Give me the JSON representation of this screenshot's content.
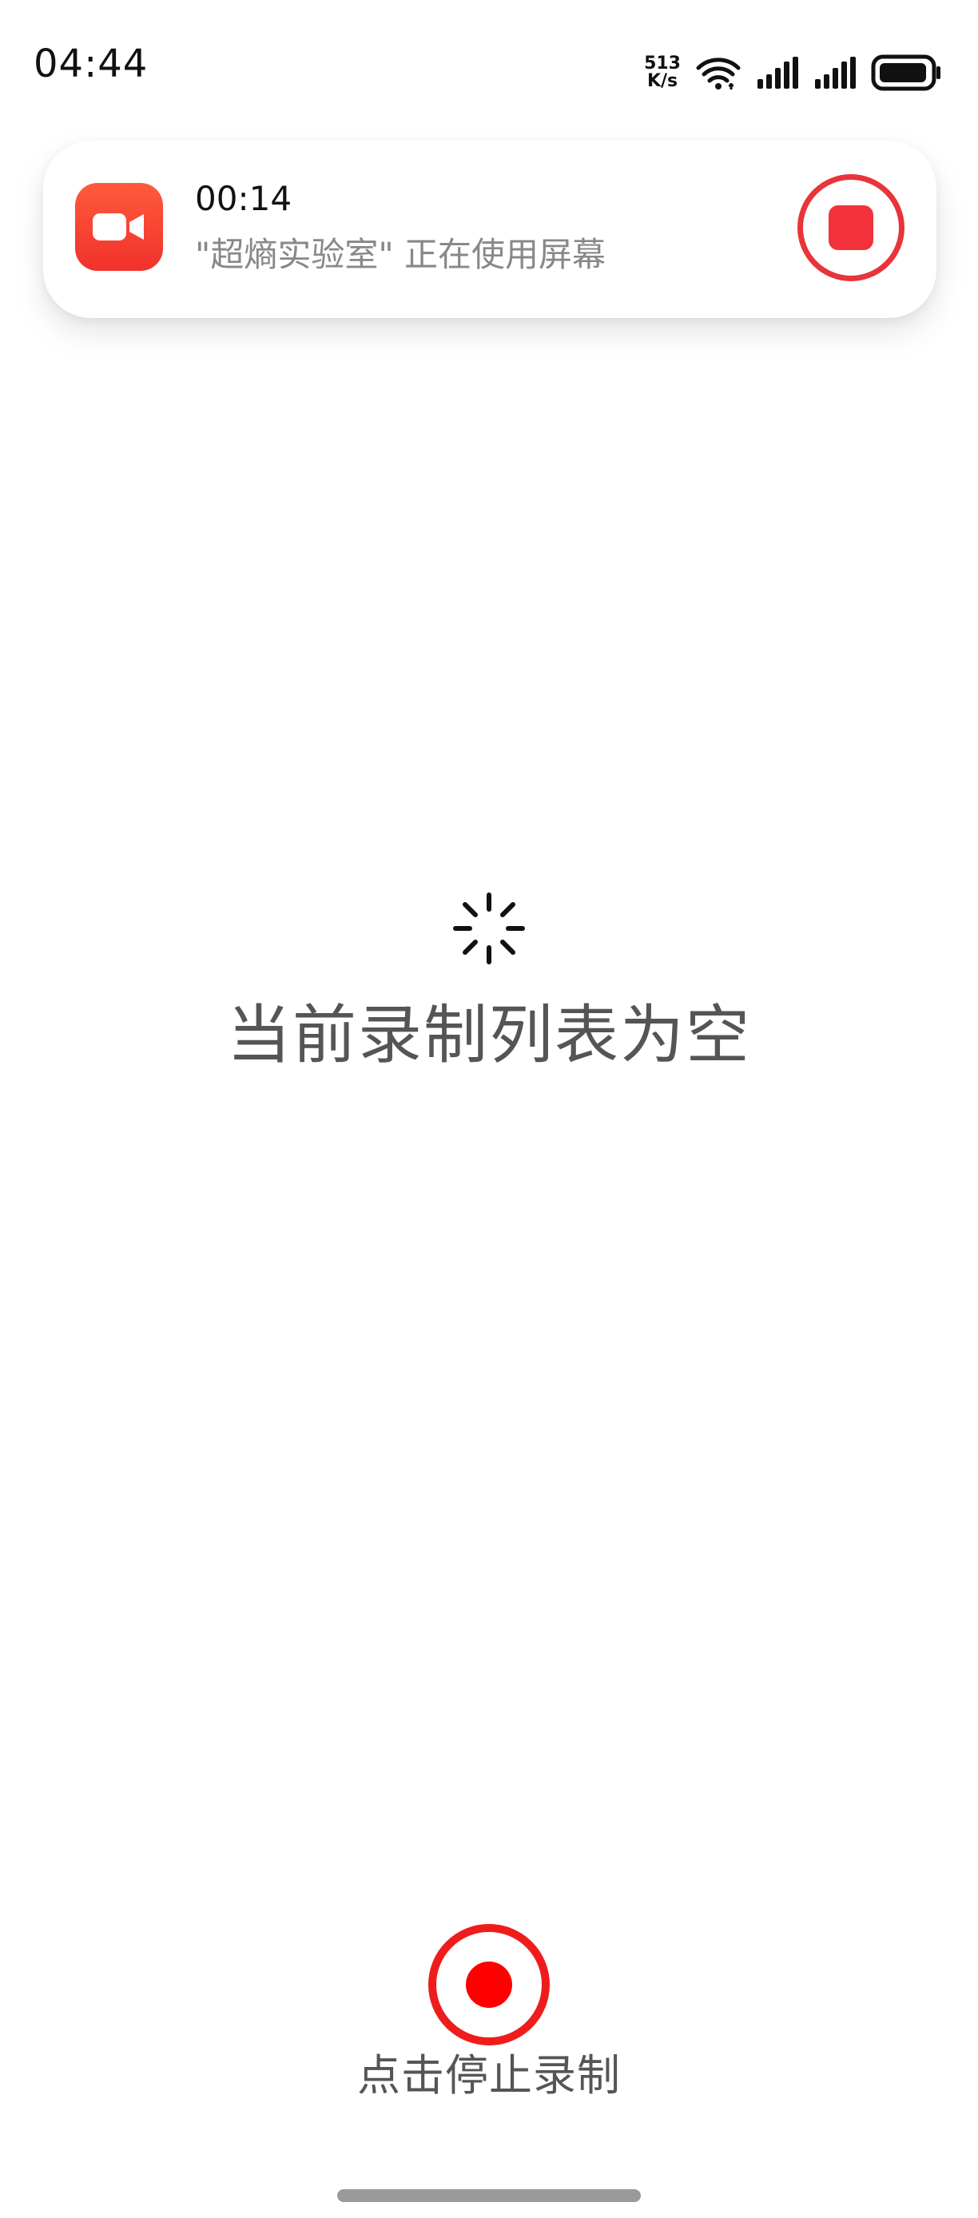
{
  "status_bar": {
    "time": "04:44",
    "net_speed_value": "513",
    "net_speed_unit": "K/s",
    "icons": [
      "wifi-icon",
      "signal-icon",
      "signal-icon",
      "battery-icon"
    ]
  },
  "notification": {
    "app_icon": "video-camera-icon",
    "elapsed": "00:14",
    "description": "\"超熵实验室\" 正在使用屏幕",
    "stop_icon": "stop-icon",
    "accent_color": "#f1323b"
  },
  "main": {
    "loading_icon": "spinner-icon",
    "empty_message": "当前录制列表为空"
  },
  "record_control": {
    "icon": "record-icon",
    "label": "点击停止录制",
    "color": "#ff0000"
  }
}
